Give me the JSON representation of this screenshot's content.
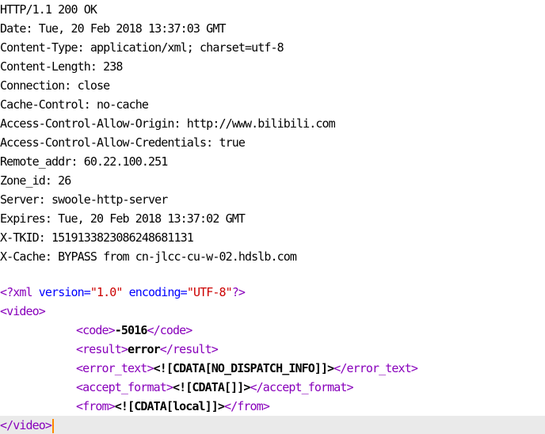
{
  "http_headers": [
    "HTTP/1.1 200 OK",
    "Date: Tue, 20 Feb 2018 13:37:03 GMT",
    "Content-Type: application/xml; charset=utf-8",
    "Content-Length: 238",
    "Connection: close",
    "Cache-Control: no-cache",
    "Access-Control-Allow-Origin: http://www.bilibili.com",
    "Access-Control-Allow-Credentials: true",
    "Remote_addr: 60.22.100.251",
    "Zone_id: 26",
    "Server: swoole-http-server",
    "Expires: Tue, 20 Feb 2018 13:37:02 GMT",
    "X-TKID: 1519133823086248681131",
    "X-Cache: BYPASS from cn-jlcc-cu-w-02.hdslb.com"
  ],
  "xml": {
    "pi_open": "<?xml",
    "version_attr": "version=",
    "version_value": "\"1.0\"",
    "encoding_attr": "encoding=",
    "encoding_value": "\"UTF-8\"",
    "pi_close": "?>",
    "video_open": "<video>",
    "video_close": "</video>",
    "code_open": "<code>",
    "code_value": "-5016",
    "code_close": "</code>",
    "result_open": "<result>",
    "result_value": "error",
    "result_close": "</result>",
    "error_text_open": "<error_text>",
    "error_text_value": "<![CDATA[NO_DISPATCH_INFO]]>",
    "error_text_close": "</error_text>",
    "accept_format_open": "<accept_format>",
    "accept_format_value": "<![CDATA[]]>",
    "accept_format_close": "</accept_format>",
    "from_open": "<from>",
    "from_value": "<![CDATA[local]]>",
    "from_close": "</from>"
  },
  "colors": {
    "tag": "#8800bb",
    "attribute": "#0000ff",
    "string": "#cc0000",
    "cursor": "#ff8800",
    "current_line": "#eaeaea"
  }
}
